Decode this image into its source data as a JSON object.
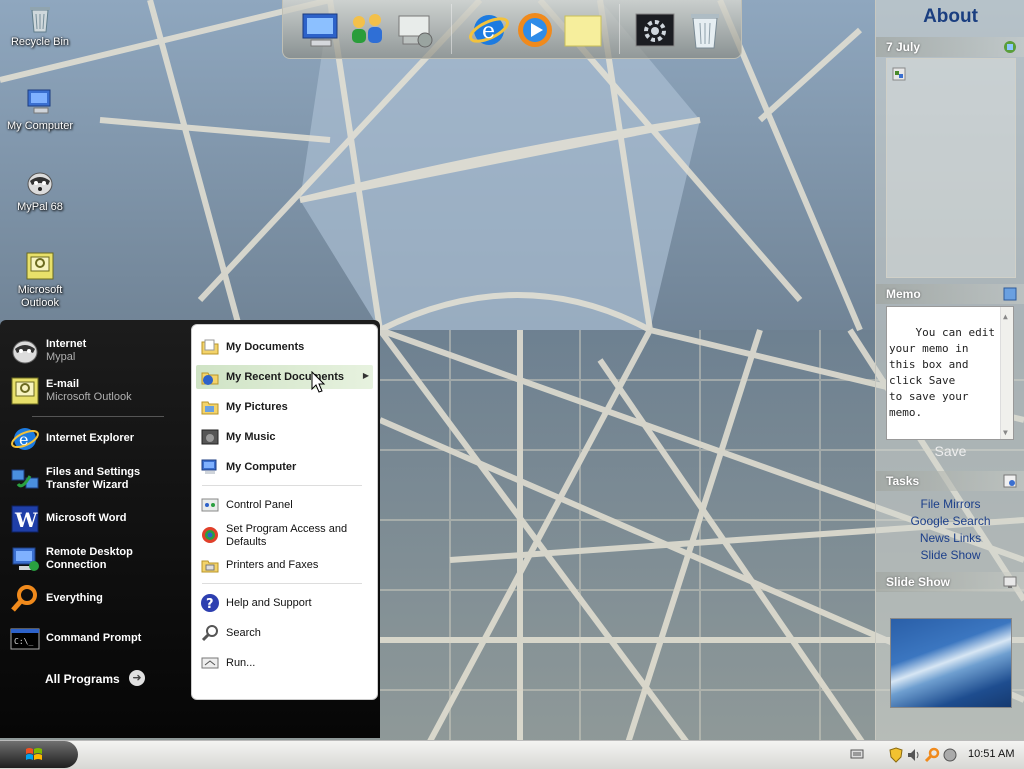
{
  "desktop": {
    "icons": [
      {
        "label": "Recycle Bin",
        "icon": "recycle-bin-icon"
      },
      {
        "label": "My Computer",
        "icon": "my-computer-icon"
      },
      {
        "label": "MyPal 68",
        "icon": "mypal-icon"
      },
      {
        "label": "Microsoft Outlook",
        "icon": "outlook-icon"
      }
    ]
  },
  "dock": {
    "items": [
      "my-computer-icon",
      "users-icon",
      "network-icon",
      "internet-explorer-icon",
      "media-player-icon",
      "sticky-note-icon",
      "settings-icon",
      "recycle-bin-icon"
    ]
  },
  "sidebar": {
    "title": "About",
    "calendar_date": "7 July",
    "memo_header": "Memo",
    "memo_text": "You can edit\nyour memo in\nthis box and\nclick Save\nto save your\nmemo.",
    "save_label": "Save",
    "tasks_header": "Tasks",
    "tasks": [
      "File Mirrors",
      "Google Search",
      "News Links",
      "Slide Show"
    ],
    "slideshow_header": "Slide Show"
  },
  "start_menu": {
    "pinned": [
      {
        "label": "Internet",
        "sub": "Mypal"
      },
      {
        "label": "E-mail",
        "sub": "Microsoft Outlook"
      }
    ],
    "recent": [
      {
        "label": "Internet Explorer"
      },
      {
        "label": "Files and Settings Transfer Wizard"
      },
      {
        "label": "Microsoft Word"
      },
      {
        "label": "Remote Desktop Connection"
      },
      {
        "label": "Everything"
      },
      {
        "label": "Command Prompt"
      }
    ],
    "all_programs": "All Programs",
    "right": [
      {
        "label": "My Documents"
      },
      {
        "label": "My Recent Documents"
      },
      {
        "label": "My Pictures"
      },
      {
        "label": "My Music"
      },
      {
        "label": "My Computer"
      },
      {
        "label": "Control Panel"
      },
      {
        "label": "Set Program Access and Defaults"
      },
      {
        "label": "Printers and Faxes"
      },
      {
        "label": "Help and Support"
      },
      {
        "label": "Search"
      },
      {
        "label": "Run..."
      }
    ]
  },
  "taskbar": {
    "clock": "10:51 AM"
  },
  "colors": {
    "accent_blue": "#1c3f8a",
    "menu_hover": "#cfe3c5",
    "start_menu_bg": "#0a0a0a"
  }
}
